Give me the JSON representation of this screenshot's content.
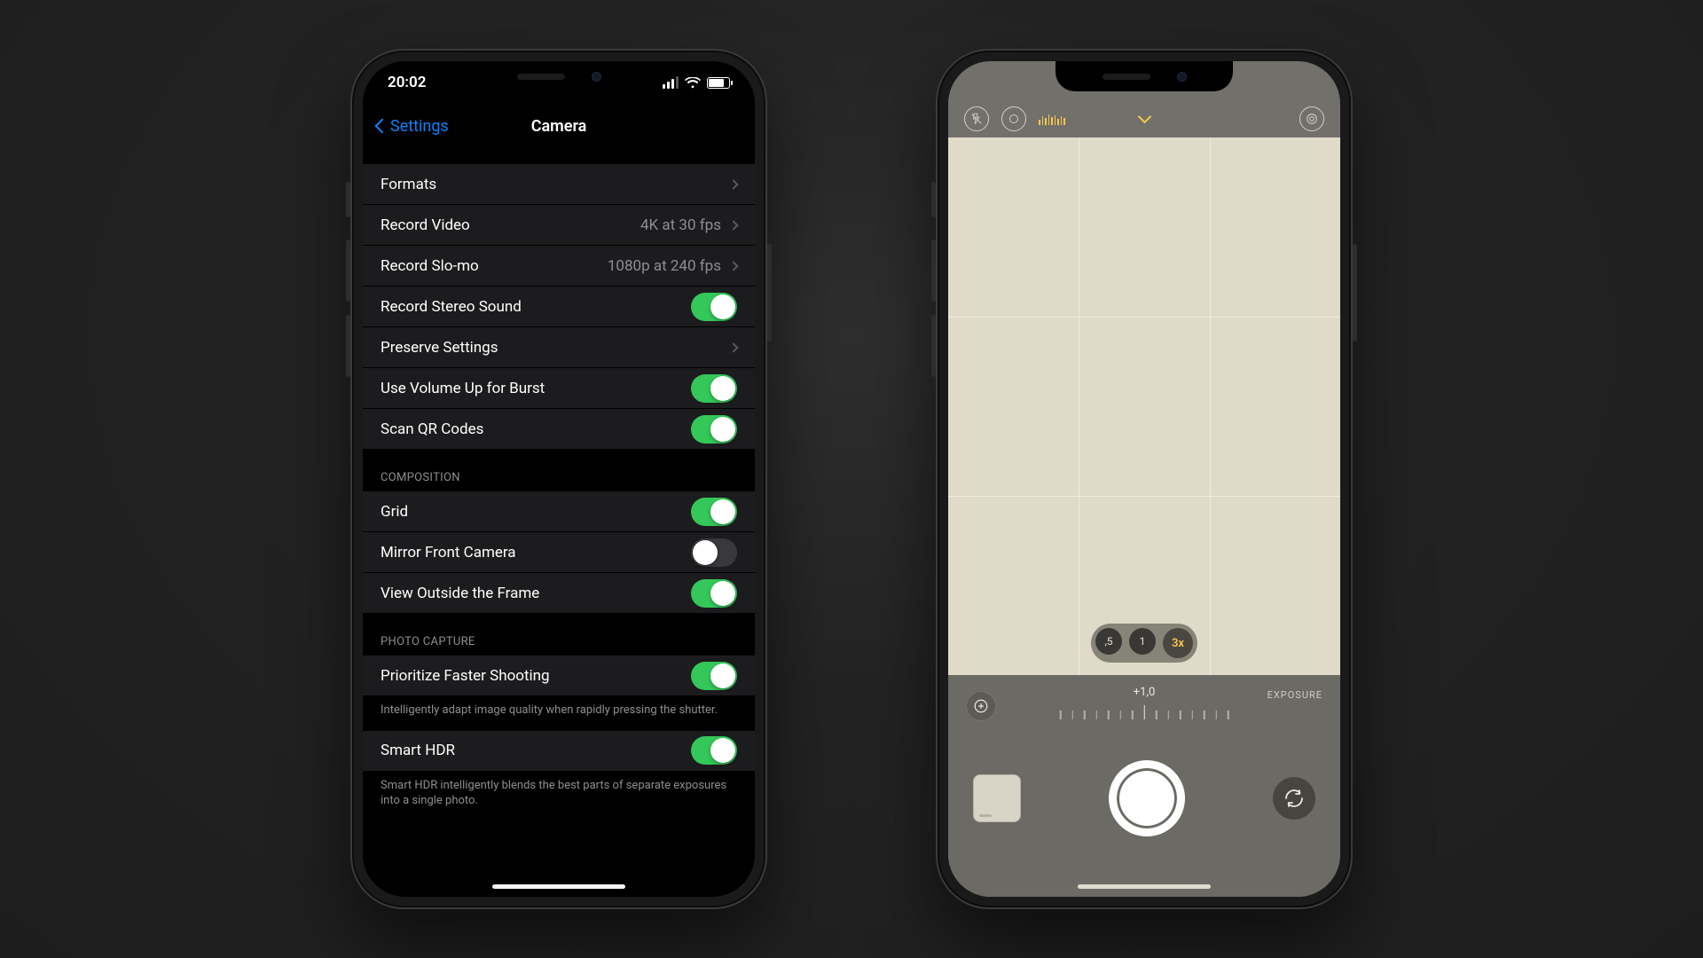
{
  "left": {
    "status": {
      "time": "20:02"
    },
    "nav": {
      "back": "Settings",
      "title": "Camera"
    },
    "rows": {
      "formats": "Formats",
      "record_video": {
        "label": "Record Video",
        "value": "4K at 30 fps"
      },
      "record_slomo": {
        "label": "Record Slo-mo",
        "value": "1080p at 240 fps"
      },
      "stereo": {
        "label": "Record Stereo Sound",
        "on": true
      },
      "preserve": "Preserve Settings",
      "burst": {
        "label": "Use Volume Up for Burst",
        "on": true
      },
      "qr": {
        "label": "Scan QR Codes",
        "on": true
      }
    },
    "composition": {
      "header": "Composition",
      "grid": {
        "label": "Grid",
        "on": true
      },
      "mirror": {
        "label": "Mirror Front Camera",
        "on": false
      },
      "outside": {
        "label": "View Outside the Frame",
        "on": true
      }
    },
    "capture": {
      "header": "Photo Capture",
      "prioritize": {
        "label": "Prioritize Faster Shooting",
        "on": true
      },
      "prioritize_note": "Intelligently adapt image quality when rapidly pressing the shutter.",
      "smart_hdr": {
        "label": "Smart HDR",
        "on": true
      },
      "smart_hdr_note": "Smart HDR intelligently blends the best parts of separate exposures into a single photo."
    }
  },
  "right": {
    "zoom": {
      "a": ",5",
      "b": "1",
      "c": "3x"
    },
    "exposure": {
      "label": "EXPOSURE",
      "value": "+1,0"
    },
    "icons": {
      "flash": "flash-off-icon",
      "live": "live-photo-icon",
      "target": "raw-icon",
      "expand": "chevron-down-icon",
      "exposure_btn": "exposure-adjust-icon",
      "thumb": "last-photo-thumbnail",
      "shutter": "shutter-button",
      "flip": "camera-flip-icon"
    }
  }
}
